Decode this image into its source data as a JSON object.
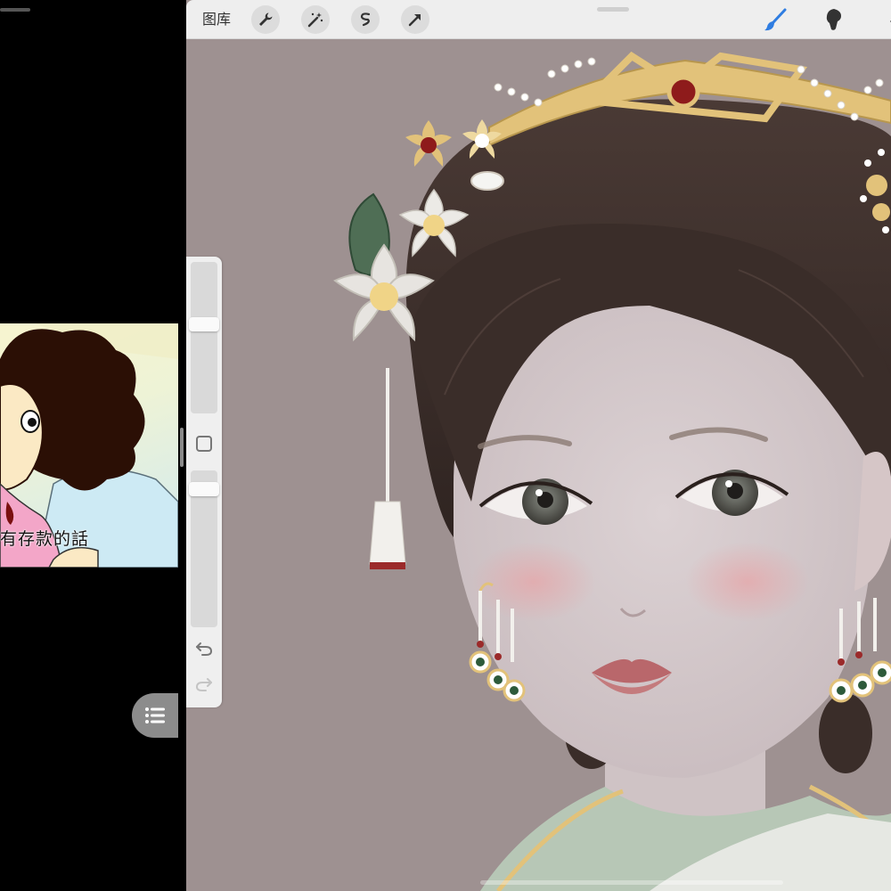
{
  "left_pane": {
    "subtitle": "有存款的話"
  },
  "toolbar": {
    "gallery_label": "图库",
    "tools": [
      {
        "name": "wrench-icon"
      },
      {
        "name": "magic-wand-icon"
      },
      {
        "name": "selection-icon"
      },
      {
        "name": "transform-arrow-icon"
      }
    ],
    "right_tools": [
      {
        "name": "brush-icon"
      },
      {
        "name": "smudge-icon"
      },
      {
        "name": "eraser-icon"
      }
    ]
  },
  "sidebar": {
    "brush_size_level": 0.6,
    "opacity_level": 0.92
  },
  "colors": {
    "canvas_background": "#9e9191",
    "toolbar": "#eeeeee",
    "accent_blue": "#2f7de1",
    "hair": "#3b2e2b",
    "skin": "#d9cccd",
    "gold": "#e2c27a"
  }
}
